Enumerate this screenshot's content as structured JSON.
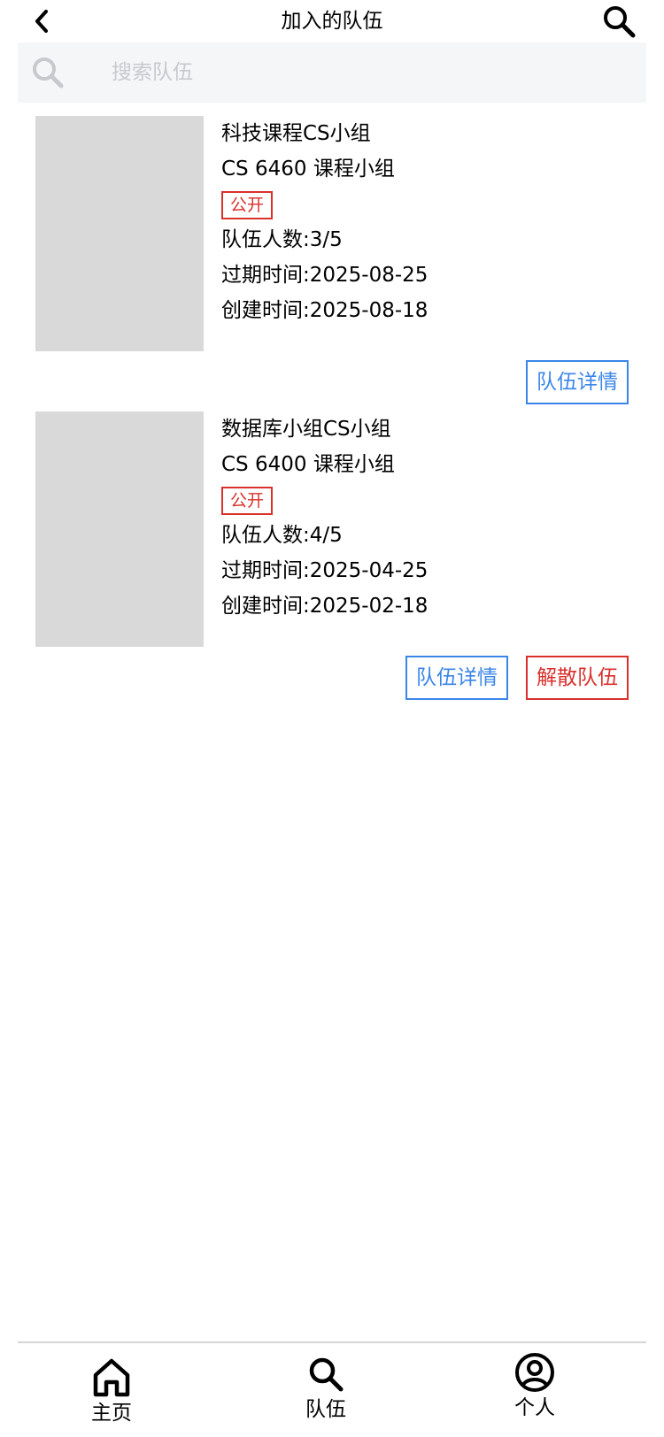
{
  "header": {
    "title": "加入的队伍",
    "back_icon": "chevron-left-icon",
    "search_icon": "search-icon"
  },
  "search": {
    "placeholder": "搜索队伍",
    "value": "",
    "icon": "search-icon"
  },
  "teams": [
    {
      "name": "科技课程CS小组",
      "course": "CS 6460 课程小组",
      "visibility": "公开",
      "members_label": "队伍人数: ",
      "members": "3/5",
      "expire_label": "过期时间: ",
      "expire": "2025-08-25",
      "created_label": "创建时间: ",
      "created": "2025-08-18",
      "actions": [
        "队伍详情"
      ]
    },
    {
      "name": "数据库小组CS小组",
      "course": "CS 6400 课程小组",
      "visibility": "公开",
      "members_label": "队伍人数: ",
      "members": "4/5",
      "expire_label": "过期时间: ",
      "expire": "2025-04-25",
      "created_label": "创建时间: ",
      "created": "2025-02-18",
      "actions": [
        "队伍详情",
        "解散队伍"
      ]
    }
  ],
  "tabbar": {
    "items": [
      {
        "label": "主页",
        "icon": "home-icon"
      },
      {
        "label": "队伍",
        "icon": "search-icon"
      },
      {
        "label": "个人",
        "icon": "user-circle-icon"
      }
    ]
  },
  "colors": {
    "accent_blue": "#3a86e8",
    "danger_red": "#d9302c",
    "placeholder_gray": "#d9d9d9",
    "search_bg": "#f5f6f8"
  }
}
